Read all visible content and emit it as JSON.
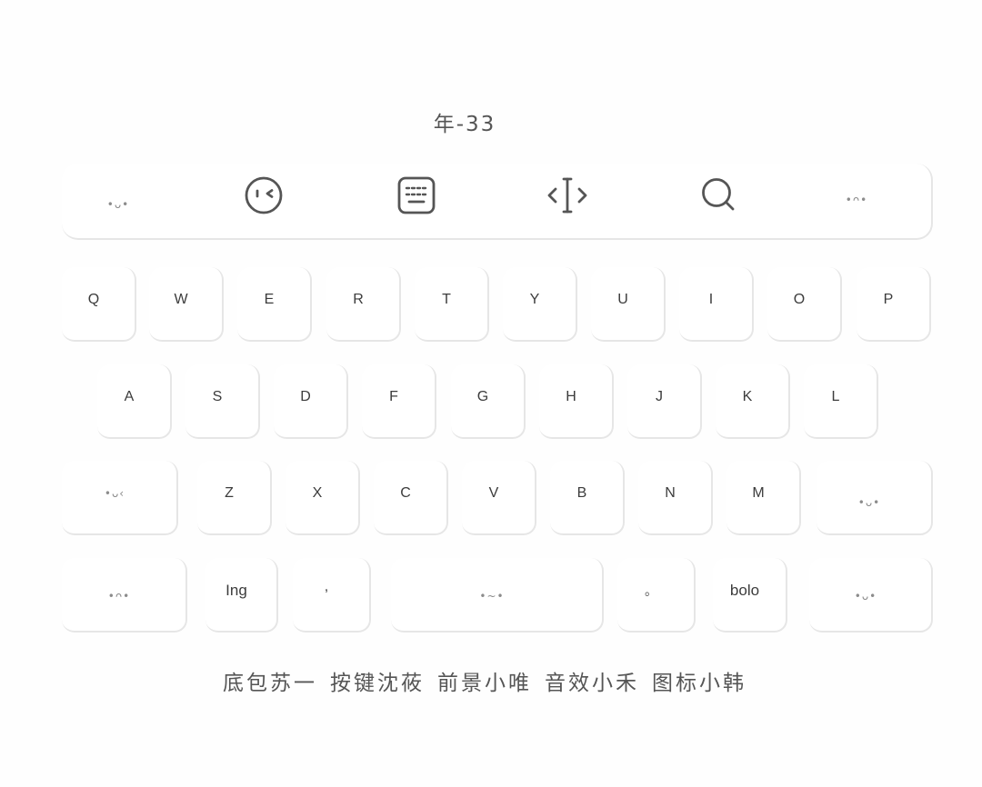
{
  "title": "年-33",
  "toolbar": {
    "left_face": "•ᴗ•",
    "right_face": "•ᴖ•",
    "icons": {
      "emoji": "emoji-face-icon",
      "keyboard": "keyboard-icon",
      "cursor": "text-cursor-icon",
      "search": "search-icon"
    }
  },
  "keyboard": {
    "row1": [
      "Q",
      "W",
      "E",
      "R",
      "T",
      "Y",
      "U",
      "I",
      "O",
      "P"
    ],
    "row2": [
      "A",
      "S",
      "D",
      "F",
      "G",
      "H",
      "J",
      "K",
      "L"
    ],
    "row3": {
      "shift": "•ᴗ‹",
      "letters": [
        "Z",
        "X",
        "C",
        "V",
        "B",
        "N",
        "M"
      ],
      "delete": "•ᴗ•"
    },
    "row4": {
      "left": "•ᴖ•",
      "lang": "Ing",
      "comma": ",",
      "space": "•~•",
      "period": "。",
      "bolo": "bolo",
      "right": "•ᴗ•"
    }
  },
  "credits": [
    "底包苏一",
    "按键沈莜",
    "前景小唯",
    "音效小禾",
    "图标小韩"
  ],
  "colors": {
    "background": "#fefefe",
    "key": "#ffffff",
    "key_edge": "#e6e6e6",
    "label": "#3c3c3c",
    "icon": "#555555"
  }
}
